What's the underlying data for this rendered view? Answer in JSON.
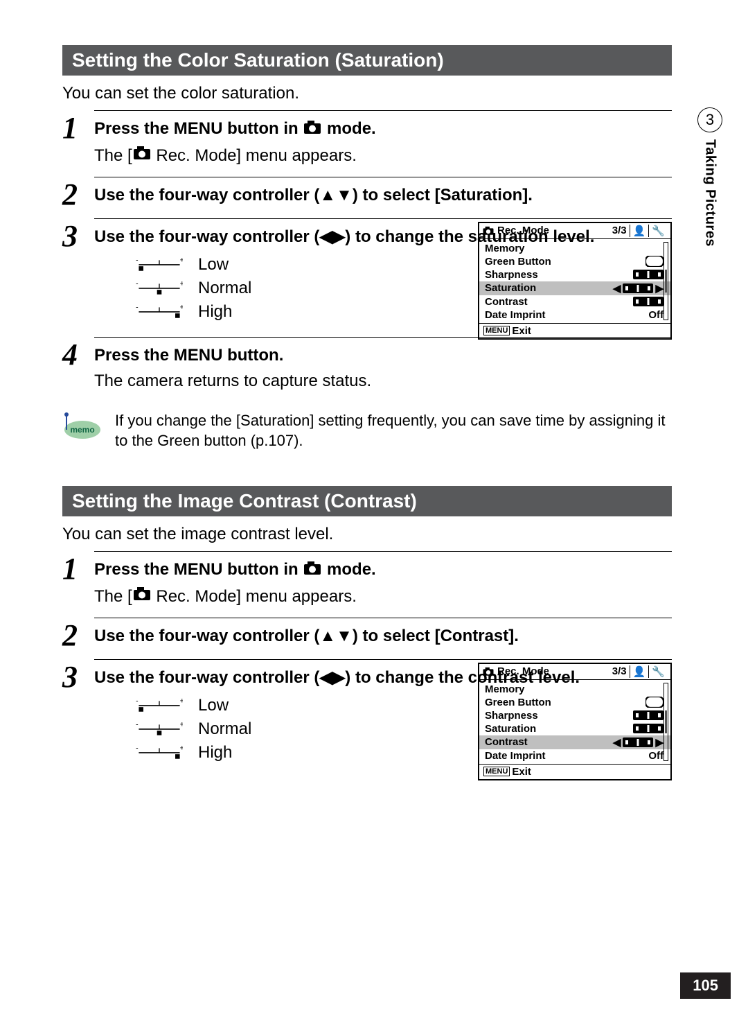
{
  "sideTab": {
    "chapterNum": "3",
    "chapterTitle": "Taking Pictures"
  },
  "pageNumber": "105",
  "sectionA": {
    "heading": "Setting the Color Saturation (Saturation)",
    "intro": "You can set the color saturation.",
    "step1": {
      "num": "1",
      "titlePre": "Press the ",
      "menuWord": "MENU",
      "titleMid": " button in ",
      "titlePost": " mode.",
      "sub": "The [",
      "sub2": " Rec. Mode] menu appears."
    },
    "step2": {
      "num": "2",
      "title": "Use the four-way controller (▲▼) to select [Saturation]."
    },
    "step3": {
      "num": "3",
      "title": "Use the four-way controller (◀▶) to change the saturation level.",
      "levels": {
        "low": "Low",
        "normal": "Normal",
        "high": "High"
      }
    },
    "step4": {
      "num": "4",
      "titlePre": "Press the ",
      "menuWord": "MENU",
      "titlePost": " button.",
      "sub": "The camera returns to capture status."
    },
    "memo": "If you change the [Saturation] setting frequently, you can save time by assigning it to the Green button (p.107)."
  },
  "sectionB": {
    "heading": "Setting the Image Contrast (Contrast)",
    "intro": "You can set the image contrast level.",
    "step1": {
      "num": "1",
      "titlePre": "Press the ",
      "menuWord": "MENU",
      "titleMid": " button in ",
      "titlePost": " mode.",
      "sub": "The [",
      "sub2": " Rec. Mode] menu appears."
    },
    "step2": {
      "num": "2",
      "title": "Use the four-way controller (▲▼) to select [Contrast]."
    },
    "step3": {
      "num": "3",
      "title": "Use the four-way controller (◀▶) to change the contrast level.",
      "levels": {
        "low": "Low",
        "normal": "Normal",
        "high": "High"
      }
    }
  },
  "lcd": {
    "title": "Rec. Mode",
    "page": "3/3",
    "rows": {
      "memory": "Memory",
      "green": "Green Button",
      "sharp": "Sharpness",
      "sat": "Saturation",
      "contrast": "Contrast",
      "date": "Date Imprint",
      "dateVal": "Off"
    },
    "exit": "Exit",
    "menuBox": "MENU"
  }
}
